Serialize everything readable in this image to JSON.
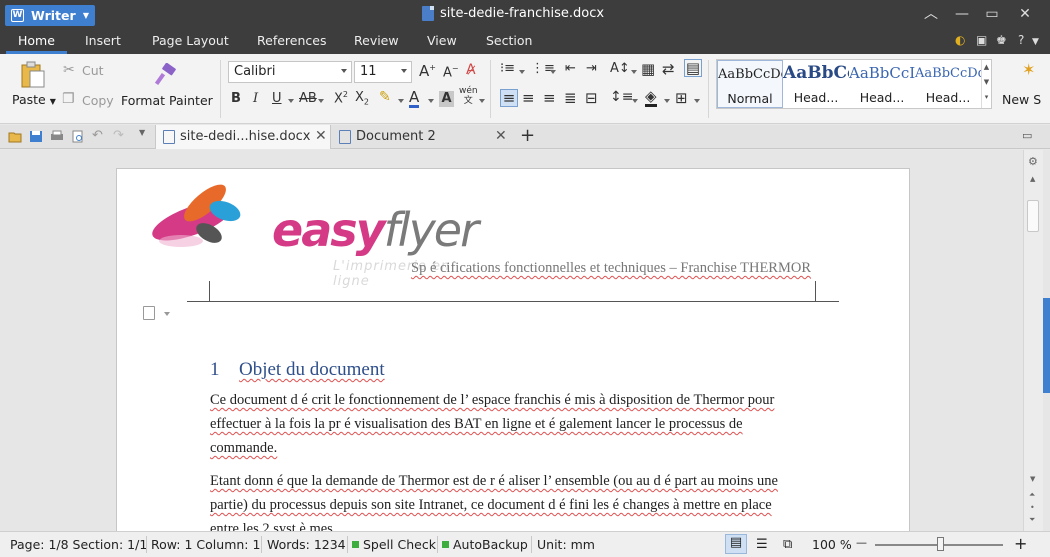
{
  "app": {
    "name": "Writer",
    "doc_title": "site-dedie-franchise.docx"
  },
  "menu": {
    "tabs": [
      "Home",
      "Insert",
      "Page Layout",
      "References",
      "Review",
      "View",
      "Section"
    ],
    "active": "Home"
  },
  "ribbon": {
    "paste": "Paste",
    "cut": "Cut",
    "copy": "Copy",
    "format_painter": "Format Painter",
    "font_name": "Calibri",
    "font_size": "11",
    "styles": [
      {
        "sample": "AaBbCcDd",
        "name": "Normal"
      },
      {
        "sample": "AaBbCc",
        "name": "Head..."
      },
      {
        "sample": "AaBbCcI",
        "name": "Head..."
      },
      {
        "sample": "AaBbCcDd",
        "name": "Head..."
      }
    ],
    "new_style": "New S"
  },
  "tabs": {
    "active_tab": "site-dedi...hise.docx",
    "other_tab": "Document 2",
    "add": "+"
  },
  "document": {
    "logo_main": "easy",
    "logo_flyer": "flyer",
    "logo_tagline": "L'imprimerie en ligne",
    "header_text": "Sp é cifications fonctionnelles et techniques  –  Franchise THERMOR",
    "heading_number": "1",
    "heading_text": "Objet du document",
    "paragraphs": [
      "Ce document d é crit le fonctionnement de l’  espace franchis é  mis  à  disposition de Thermor pour effectuer  à  la fois la pr é visualisation des BAT en ligne et  é galement lancer le processus de commande.",
      "Etant donn é  que la demande de Thermor est de r é aliser l’  ensemble (ou au d é part au moins une partie) du processus depuis son site Intranet, ce document d é fini les  é changes  à  mettre en place entre les 2 syst è mes."
    ]
  },
  "status": {
    "page": "Page: 1/8 Section: 1/1",
    "row": "Row: 1 Column: 1",
    "words": "Words: 1234",
    "spell": "Spell Check",
    "autobackup": "AutoBackup",
    "unit": "Unit: mm",
    "zoom": "100 %",
    "zoom_minus": "—",
    "zoom_plus": "+"
  },
  "colors": {
    "accent": "#3f7fd0",
    "heading": "#2f4f8a",
    "logo_pink": "#d43a86",
    "status_ok": "#3dae3d"
  }
}
